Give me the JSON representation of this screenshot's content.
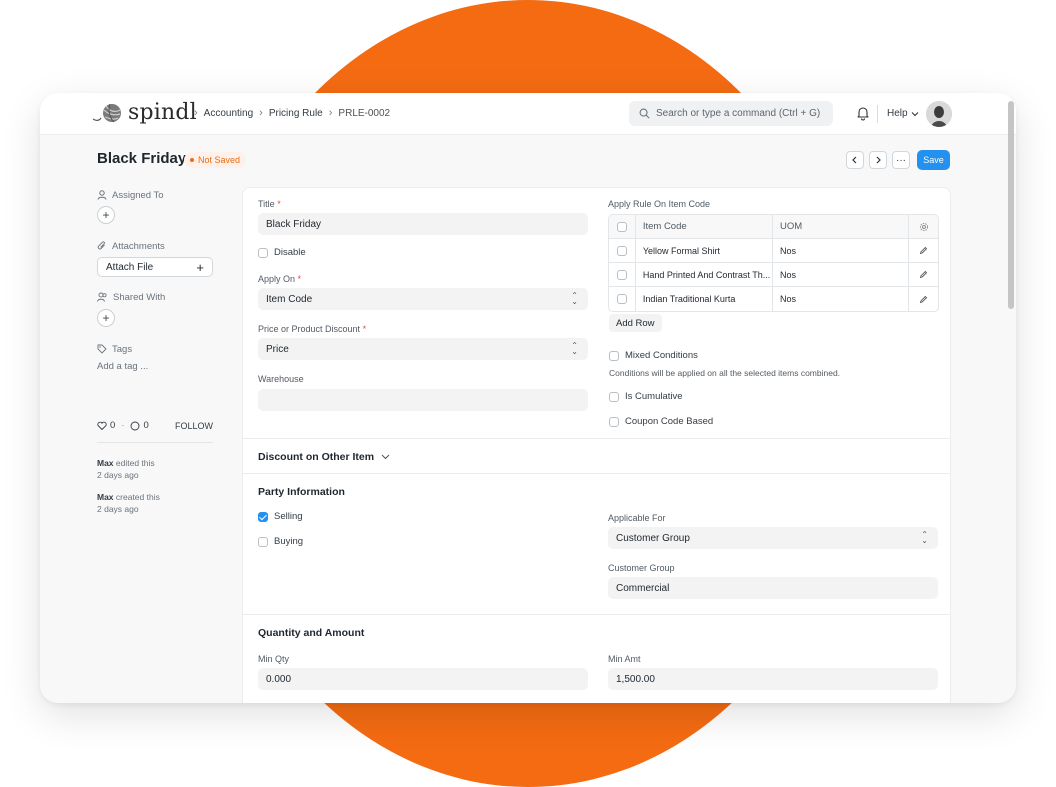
{
  "brand": {
    "name": "spindl",
    "accent": "#f46b12",
    "primary": "#2490ef"
  },
  "breadcrumb": [
    "Accounting",
    "Pricing Rule",
    "PRLE-0002"
  ],
  "search": {
    "placeholder": "Search or type a command (Ctrl + G)"
  },
  "nav": {
    "help": "Help"
  },
  "page": {
    "title": "Black Friday",
    "status": "Not Saved",
    "save": "Save",
    "more": "···"
  },
  "sidebar": {
    "assigned_to": "Assigned To",
    "attachments": "Attachments",
    "attach_file": "Attach File",
    "shared_with": "Shared With",
    "tags": "Tags",
    "add_tag": "Add a tag ...",
    "likes": "0",
    "comments": "0",
    "follow": "FOLLOW",
    "activity": [
      {
        "user": "Max",
        "action": " edited this",
        "time": "2 days ago"
      },
      {
        "user": "Max",
        "action": " created this",
        "time": "2 days ago"
      }
    ]
  },
  "form": {
    "title_label": "Title",
    "title_value": "Black Friday",
    "disable_label": "Disable",
    "apply_on_label": "Apply On",
    "apply_on_value": "Item Code",
    "price_label": "Price or Product Discount",
    "price_value": "Price",
    "warehouse_label": "Warehouse",
    "warehouse_value": "",
    "apply_rule_label": "Apply Rule On Item Code",
    "grid": {
      "columns": [
        "Item Code",
        "UOM"
      ],
      "rows": [
        {
          "item": "Yellow Formal Shirt",
          "uom": "Nos"
        },
        {
          "item": "Hand Printed And Contrast Th...",
          "uom": "Nos"
        },
        {
          "item": "Indian Traditional Kurta",
          "uom": "Nos"
        }
      ],
      "add_row": "Add Row"
    },
    "mixed_conditions": "Mixed Conditions",
    "mixed_help": "Conditions will be applied on all the selected items combined.",
    "is_cumulative": "Is Cumulative",
    "coupon_code": "Coupon Code Based"
  },
  "sections": {
    "discount_other": "Discount on Other Item",
    "party": "Party Information",
    "qty_amount": "Quantity and Amount"
  },
  "party": {
    "selling": "Selling",
    "selling_checked": true,
    "buying": "Buying",
    "buying_checked": false,
    "applicable_for_label": "Applicable For",
    "applicable_for_value": "Customer Group",
    "customer_group_label": "Customer Group",
    "customer_group_value": "Commercial"
  },
  "qty": {
    "min_qty_label": "Min Qty",
    "min_qty_value": "0.000",
    "min_amt_label": "Min Amt",
    "min_amt_value": "1,500.00"
  }
}
